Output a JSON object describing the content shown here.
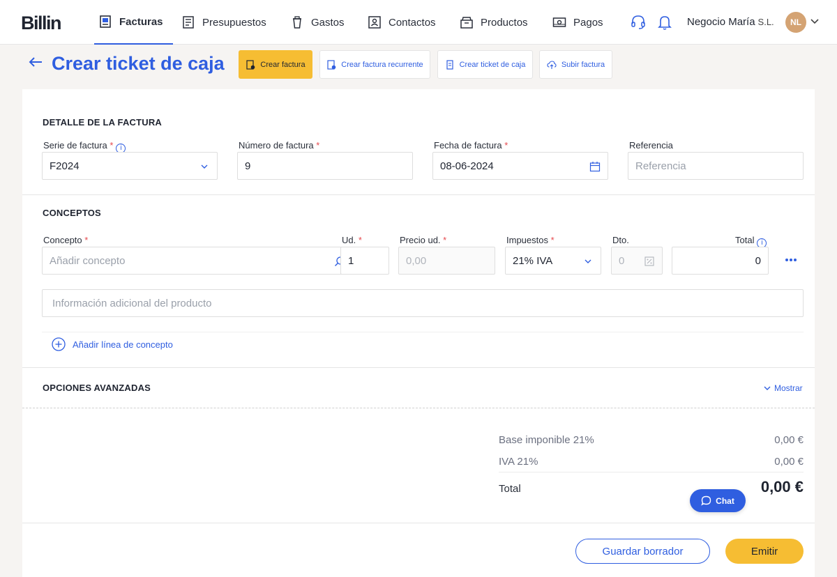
{
  "brand": {
    "logo": "Billin",
    "accent": "#2f5ee0",
    "yellow": "#f6bd33"
  },
  "nav": {
    "items": [
      {
        "label": "Facturas"
      },
      {
        "label": "Presupuestos"
      },
      {
        "label": "Gastos"
      },
      {
        "label": "Contactos"
      },
      {
        "label": "Productos"
      },
      {
        "label": "Pagos"
      }
    ],
    "company": "Negocio María",
    "company_suffix": "S.L.",
    "avatar_initials": "NL"
  },
  "header": {
    "title": "Crear ticket de caja",
    "actions": [
      {
        "label": "Crear factura"
      },
      {
        "label": "Crear factura recurrente"
      },
      {
        "label": "Crear ticket de caja"
      },
      {
        "label": "Subir factura"
      }
    ]
  },
  "detalle": {
    "title": "DETALLE DE LA FACTURA",
    "serie_label": "Serie de factura",
    "serie_value": "F2024",
    "numero_label": "Número de factura",
    "numero_value": "9",
    "fecha_label": "Fecha de factura",
    "fecha_value": "08-06-2024",
    "referencia_label": "Referencia",
    "referencia_placeholder": "Referencia"
  },
  "conceptos": {
    "title": "CONCEPTOS",
    "concepto_label": "Concepto",
    "concepto_placeholder": "Añadir concepto",
    "ud_label": "Ud.",
    "ud_value": "1",
    "precio_label": "Precio ud.",
    "precio_placeholder": "0,00",
    "impuestos_label": "Impuestos",
    "impuestos_value": "21% IVA",
    "dto_label": "Dto.",
    "dto_placeholder": "0",
    "total_label": "Total",
    "total_value": "0",
    "info_placeholder": "Información adicional del producto",
    "add_line": "Añadir línea de concepto"
  },
  "avanzadas": {
    "title": "OPCIONES AVANZADAS",
    "toggle": "Mostrar"
  },
  "resumen": {
    "base_label": "Base imponible 21%",
    "base_value": "0,00 €",
    "iva_label": "IVA 21%",
    "iva_value": "0,00 €",
    "total_label": "Total",
    "total_value": "0,00 €"
  },
  "footer": {
    "draft": "Guardar borrador",
    "emit": "Emitir",
    "chat": "Chat"
  }
}
